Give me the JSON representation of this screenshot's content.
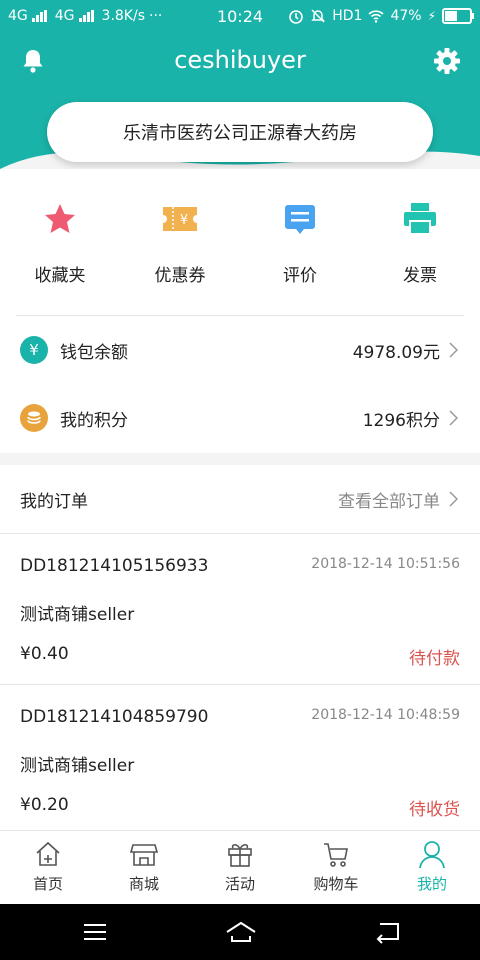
{
  "status_bar": {
    "network1": "4G",
    "network2": "4G",
    "speed": "3.8K/s",
    "dots": "···",
    "time": "10:24",
    "hd": "HD1",
    "battery_text": "47%",
    "battery_level": 0.47
  },
  "header": {
    "title": "ceshibuyer",
    "store_name": "乐清市医药公司正源春大药房",
    "accent_color": "#1ab3a9"
  },
  "quick_actions": [
    {
      "label": "收藏夹",
      "icon": "star-icon",
      "color": "#ef5a73"
    },
    {
      "label": "优惠券",
      "icon": "coupon-icon",
      "color": "#f2b14f"
    },
    {
      "label": "评价",
      "icon": "review-icon",
      "color": "#4aa3f0"
    },
    {
      "label": "发票",
      "icon": "invoice-icon",
      "color": "#22c4b1"
    }
  ],
  "wallet": {
    "label": "钱包余额",
    "value": "4978.09元",
    "icon_text": "¥"
  },
  "points": {
    "label": "我的积分",
    "value": "1296积分"
  },
  "orders_section": {
    "title": "我的订单",
    "view_all": "查看全部订单"
  },
  "orders": [
    {
      "id": "DD181214105156933",
      "time": "2018-12-14 10:51:56",
      "shop": "测试商铺seller",
      "price": "¥0.40",
      "status": "待付款"
    },
    {
      "id": "DD181214104859790",
      "time": "2018-12-14 10:48:59",
      "shop": "测试商铺seller",
      "price": "¥0.20",
      "status": "待收货"
    }
  ],
  "tabs": [
    {
      "label": "首页",
      "icon": "home-icon"
    },
    {
      "label": "商城",
      "icon": "store-icon"
    },
    {
      "label": "活动",
      "icon": "gift-icon"
    },
    {
      "label": "购物车",
      "icon": "cart-icon"
    },
    {
      "label": "我的",
      "icon": "profile-icon",
      "active": true
    }
  ]
}
